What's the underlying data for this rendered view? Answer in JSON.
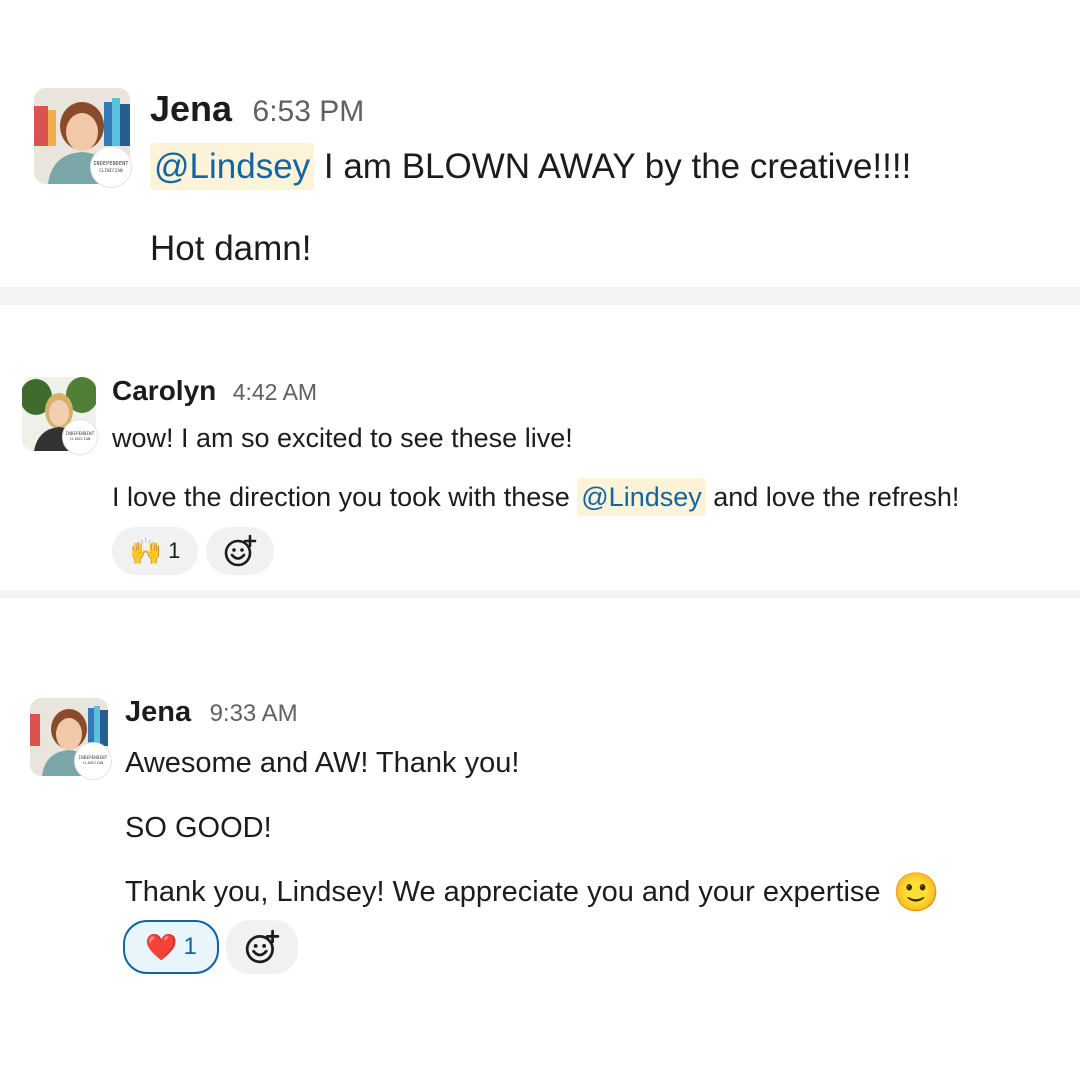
{
  "messages": [
    {
      "author": "Jena",
      "time": "6:53 PM",
      "badge": [
        "INDEPENDENT",
        "CLINICIAN"
      ],
      "lines": [
        {
          "mention": "@Lindsey",
          "text": " I am BLOWN AWAY by the creative!!!!"
        },
        {
          "text": "Hot damn!"
        }
      ]
    },
    {
      "author": "Carolyn",
      "time": "4:42 AM",
      "badge": [
        "INDEPENDENT",
        "CLINICIAN"
      ],
      "lines": [
        {
          "text": "wow! I am so excited to see these live!"
        },
        {
          "before": "I love the direction you took with these ",
          "mention": "@Lindsey",
          "after": " and love the refresh!"
        }
      ],
      "reactions": [
        {
          "emoji": "🙌",
          "count": "1",
          "active": false
        }
      ]
    },
    {
      "author": "Jena",
      "time": "9:33 AM",
      "badge": [
        "INDEPENDENT",
        "CLINICIAN"
      ],
      "lines": [
        {
          "text": "Awesome and AW! Thank you!"
        },
        {
          "text": "SO GOOD!"
        },
        {
          "text": "Thank you, Lindsey! We appreciate you and your expertise",
          "emoji": "🙂"
        }
      ],
      "reactions": [
        {
          "emoji": "❤️",
          "count": "1",
          "active": true
        }
      ]
    }
  ],
  "icons": {
    "add_reaction": "add-reaction-icon",
    "colors": {
      "mention_bg": "#fdf3d8",
      "mention_text": "#1264a3",
      "active_reaction_border": "#1264a3"
    }
  }
}
